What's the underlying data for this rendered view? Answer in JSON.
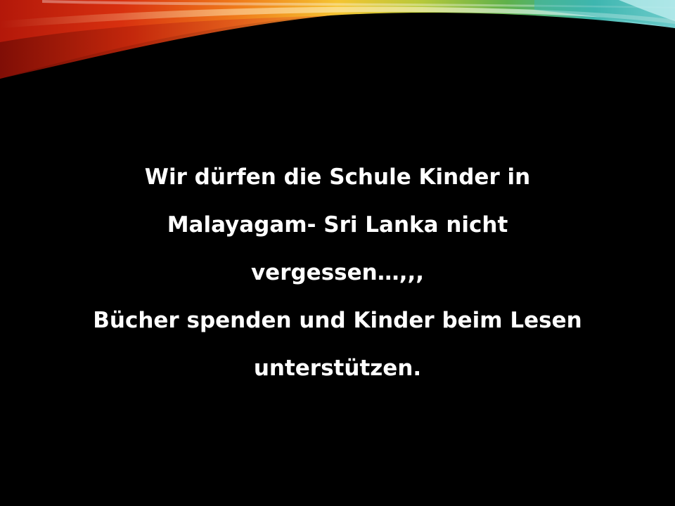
{
  "slide": {
    "lines": [
      "Wir dürfen die Schule Kinder in",
      "Malayagam- Sri Lanka nicht",
      "vergessen…,,,",
      "Bücher spenden und Kinder beim Lesen",
      "unterstützen."
    ]
  },
  "colors": {
    "background": "#000000",
    "text": "#ffffff",
    "swoosh_red": "#c81e0c",
    "swoosh_orange": "#f07a1a",
    "swoosh_yellow": "#f2c42a",
    "swoosh_green": "#6bb33a",
    "swoosh_teal": "#3fb6b0",
    "swoosh_cyan": "#9fe3ea"
  }
}
